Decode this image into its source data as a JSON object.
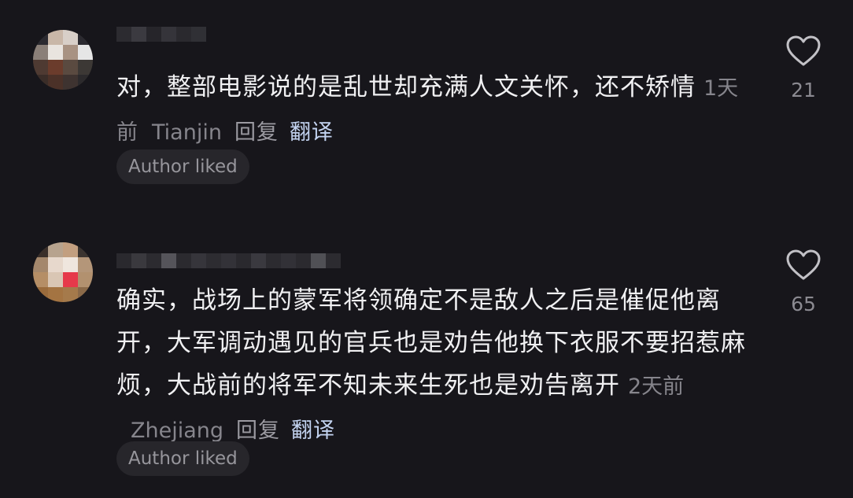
{
  "comments": [
    {
      "text": "对，整部电影说的是乱世却充满人文关怀，还不矫情",
      "time": "1天前",
      "location": "Tianjin",
      "reply_label": "回复",
      "translate_label": "翻译",
      "badge": "Author liked",
      "like_count": "21",
      "like_icon": "heart-outline-icon"
    },
    {
      "text": "确实，战场上的蒙军将领确定不是敌人之后是催促他离开，大军调动遇见的官兵也是劝告他换下衣服不要招惹麻烦，大战前的将军不知未来生死也是劝告离开",
      "time": "2天前",
      "location": "Zhejiang",
      "reply_label": "回复",
      "translate_label": "翻译",
      "badge": "Author liked",
      "like_count": "65",
      "like_icon": "heart-outline-icon"
    }
  ],
  "colors": {
    "background": "#17161b",
    "text": "#f0f0f2",
    "meta": "#86858c",
    "translate": "#c3d3f0",
    "badge_bg": "#27262b"
  }
}
